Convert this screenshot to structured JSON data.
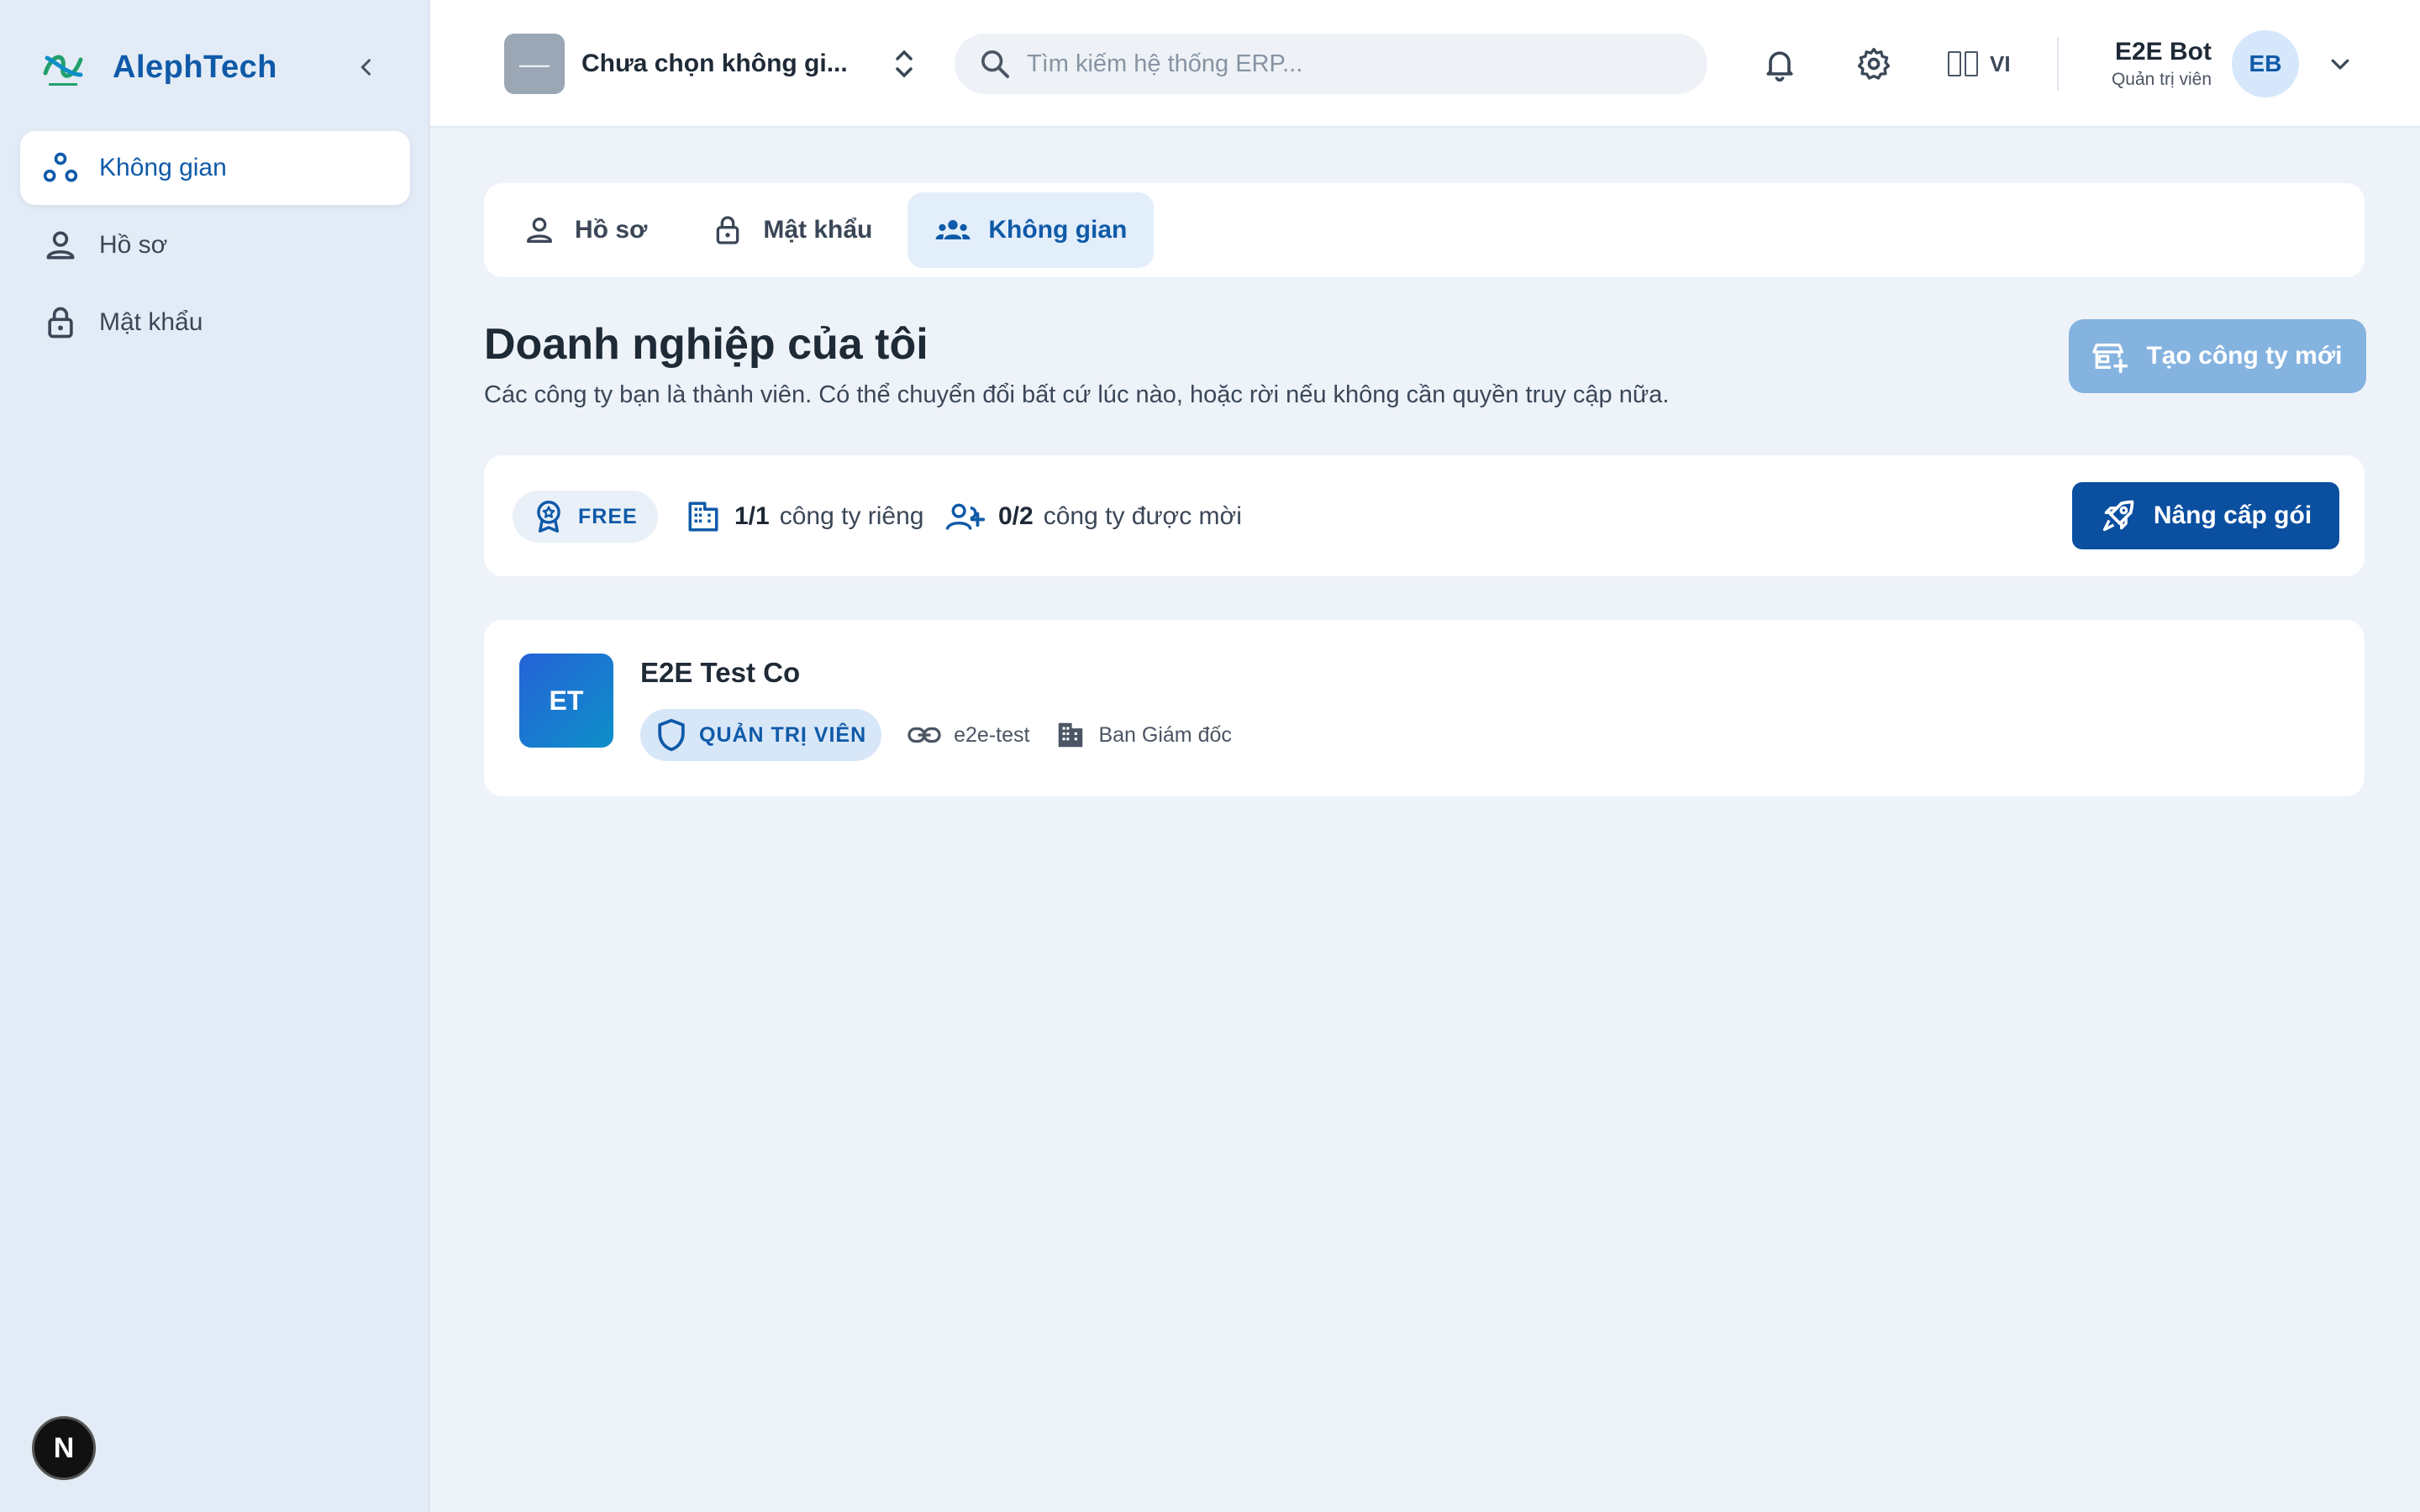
{
  "brand": {
    "name": "AlephTech",
    "logo_text": "AlephTech"
  },
  "sidebar": {
    "items": [
      {
        "label": "Không gian",
        "icon": "workspace-icon",
        "active": true
      },
      {
        "label": "Hồ sơ",
        "icon": "user-icon",
        "active": false
      },
      {
        "label": "Mật khẩu",
        "icon": "lock-icon",
        "active": false
      }
    ],
    "footer_badge": "N"
  },
  "header": {
    "workspace": {
      "thumb": "—",
      "name": "Chưa chọn không gi..."
    },
    "search": {
      "placeholder": "Tìm kiếm hệ thống ERP..."
    },
    "language": "VI",
    "user": {
      "name": "E2E Bot",
      "role": "Quản trị viên",
      "initials": "EB"
    }
  },
  "tabs": [
    {
      "label": "Hồ sơ",
      "icon": "user-icon",
      "active": false
    },
    {
      "label": "Mật khẩu",
      "icon": "lock-icon",
      "active": false
    },
    {
      "label": "Không gian",
      "icon": "group-icon",
      "active": true
    }
  ],
  "main": {
    "title": "Doanh nghiệp của tôi",
    "subtitle": "Các công ty bạn là thành viên. Có thể chuyển đổi bất cứ lúc nào, hoặc rời nếu không cần quyền truy cập nữa.",
    "create_button": "Tạo công ty mới"
  },
  "plan": {
    "badge": "FREE",
    "own": {
      "count": "1/1",
      "label": "công ty riêng"
    },
    "invited": {
      "count": "0/2",
      "label": "công ty được mời"
    },
    "upgrade_button": "Nâng cấp gói"
  },
  "companies": [
    {
      "initials": "ET",
      "name": "E2E Test Co",
      "role": "QUẢN TRỊ VIÊN",
      "slug": "e2e-test",
      "department": "Ban Giám đốc"
    }
  ],
  "colors": {
    "primary": "#0f5aa8",
    "sidebar_bg": "#e3ecf6",
    "page_bg": "#eef3f9",
    "upgrade_bg": "#0b4fa0",
    "create_bg": "#85b3e0"
  }
}
